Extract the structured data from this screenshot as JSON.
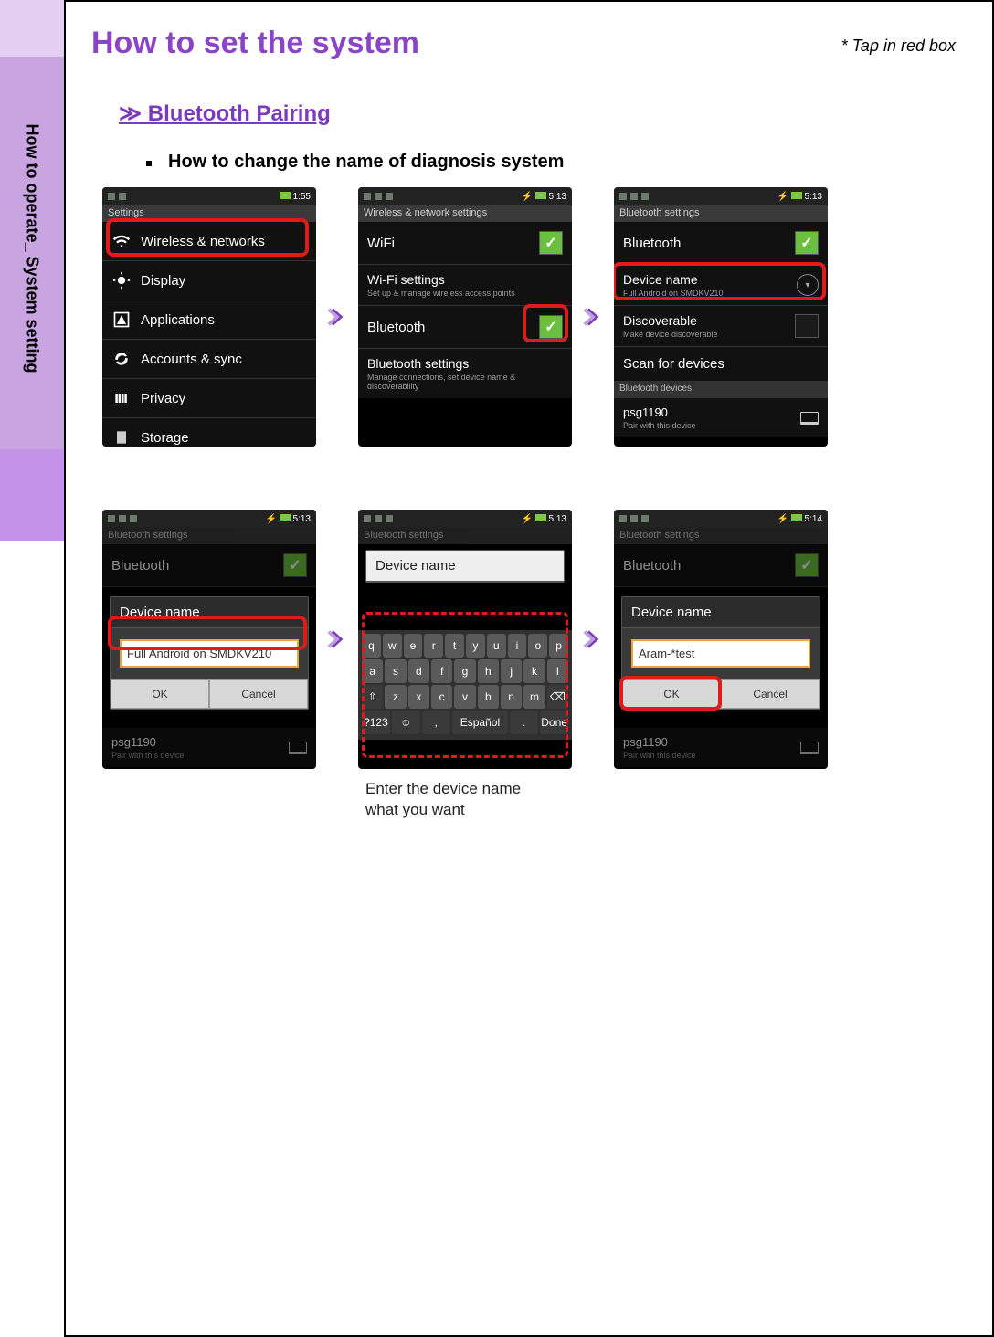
{
  "sidebar_label": "How to operate_ System setting",
  "title": "How to set the system",
  "hint": "* Tap in red box",
  "subhead": "≫  Bluetooth Pairing",
  "step_title": "How to change the name of diagnosis system",
  "caption_line1": "Enter the device name",
  "caption_line2": "what you want",
  "screens": {
    "s1": {
      "time": "1:55",
      "header": "Settings",
      "rows": {
        "wireless": "Wireless & networks",
        "display": "Display",
        "apps": "Applications",
        "accounts": "Accounts & sync",
        "privacy": "Privacy",
        "storage": "Storage"
      }
    },
    "s2": {
      "time": "5:13",
      "header": "Wireless & network settings",
      "wifi": "WiFi",
      "wifi_settings": "Wi-Fi settings",
      "wifi_sub": "Set up & manage wireless access points",
      "bt": "Bluetooth",
      "bt_settings": "Bluetooth settings",
      "bt_sub": "Manage connections, set device name & discoverability"
    },
    "s3": {
      "time": "5:13",
      "header": "Bluetooth settings",
      "bt": "Bluetooth",
      "devname": "Device name",
      "devname_sub": "Full Android on SMDKV210",
      "discoverable": "Discoverable",
      "discoverable_sub": "Make device discoverable",
      "scan": "Scan for devices",
      "devices_head": "Bluetooth devices",
      "device1": "psg1190",
      "device1_sub": "Pair with this device"
    },
    "s4": {
      "time": "5:13",
      "header": "Bluetooth settings",
      "bt": "Bluetooth",
      "dialog_title": "Device name",
      "input_value": "Full Android on SMDKV210",
      "ok": "OK",
      "cancel": "Cancel",
      "device1": "psg1190",
      "device1_sub": "Pair with this device"
    },
    "s5": {
      "time": "5:13",
      "header": "Bluetooth settings",
      "dialog_title": "Device name",
      "kb_row1": [
        "q",
        "w",
        "e",
        "r",
        "t",
        "y",
        "u",
        "i",
        "o",
        "p"
      ],
      "kb_row2": [
        "a",
        "s",
        "d",
        "f",
        "g",
        "h",
        "j",
        "k",
        "l"
      ],
      "kb_row3": [
        "⇧",
        "z",
        "x",
        "c",
        "v",
        "b",
        "n",
        "m",
        "⌫"
      ],
      "kb_row4": [
        "?123",
        "☺",
        ",",
        "Español",
        ".",
        "Done"
      ]
    },
    "s6": {
      "time": "5:14",
      "header": "Bluetooth settings",
      "bt": "Bluetooth",
      "dialog_title": "Device name",
      "input_value": "Aram-*test",
      "ok": "OK",
      "cancel": "Cancel",
      "device1": "psg1190",
      "device1_sub": "Pair with this device"
    }
  }
}
